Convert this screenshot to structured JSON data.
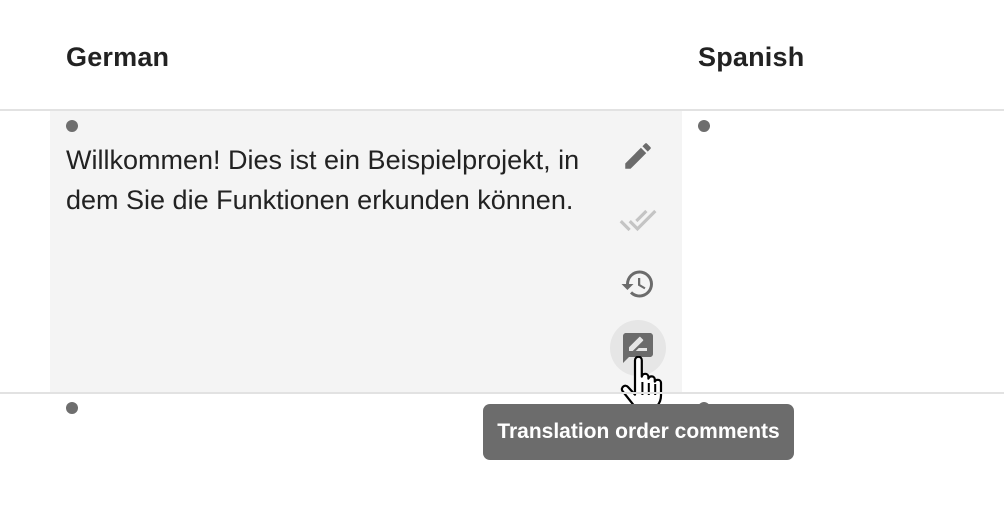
{
  "columns": {
    "german": "German",
    "spanish": "Spanish"
  },
  "rows": [
    {
      "german_text": "Willkommen! Dies ist ein Beispielprojekt, in dem Sie die Funktionen erkunden können.",
      "spanish_text": ""
    }
  ],
  "actions": [
    {
      "icon": "pencil-icon",
      "label": "Edit",
      "state": "enabled"
    },
    {
      "icon": "double-check-icon",
      "label": "Approve",
      "state": "disabled"
    },
    {
      "icon": "history-icon",
      "label": "History",
      "state": "enabled"
    },
    {
      "icon": "comment-edit-icon",
      "label": "Translation order comments",
      "state": "hovered"
    }
  ],
  "tooltip": {
    "text": "Translation order comments"
  },
  "colors": {
    "cell_background": "#f4f4f4",
    "icon": "#6b6b6b",
    "icon_disabled": "#c4c4c4",
    "tooltip_background": "#6c6c6c",
    "status_dot": "#6e6e6e"
  }
}
